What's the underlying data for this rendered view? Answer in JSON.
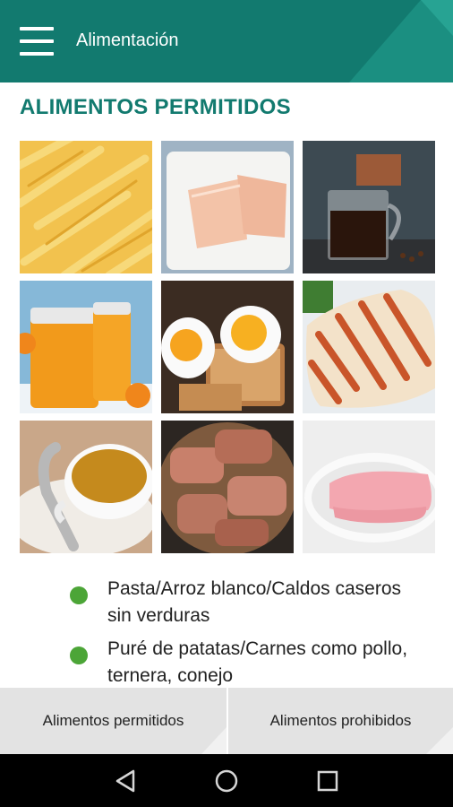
{
  "app": {
    "title": "Alimentación",
    "accent_color": "#127a6f",
    "bullet_color": "#4ca537"
  },
  "section": {
    "title": "ALIMENTOS PERMITIDOS"
  },
  "images": [
    {
      "name": "pasta-image"
    },
    {
      "name": "turkey-slices-image"
    },
    {
      "name": "coffee-image"
    },
    {
      "name": "orange-juice-image"
    },
    {
      "name": "eggs-toast-image"
    },
    {
      "name": "grilled-chicken-image"
    },
    {
      "name": "broth-cup-image"
    },
    {
      "name": "roasted-meat-image"
    },
    {
      "name": "ham-image"
    }
  ],
  "items": [
    {
      "text": "Pasta/Arroz blanco/Caldos caseros sin verduras"
    },
    {
      "text": "Puré de patatas/Carnes como pollo, ternera, conejo"
    }
  ],
  "tabs": {
    "left": "Alimentos permitidos",
    "right": "Alimentos prohibidos"
  },
  "navigation": {
    "icons": [
      "back-icon",
      "home-icon",
      "recents-icon"
    ]
  }
}
